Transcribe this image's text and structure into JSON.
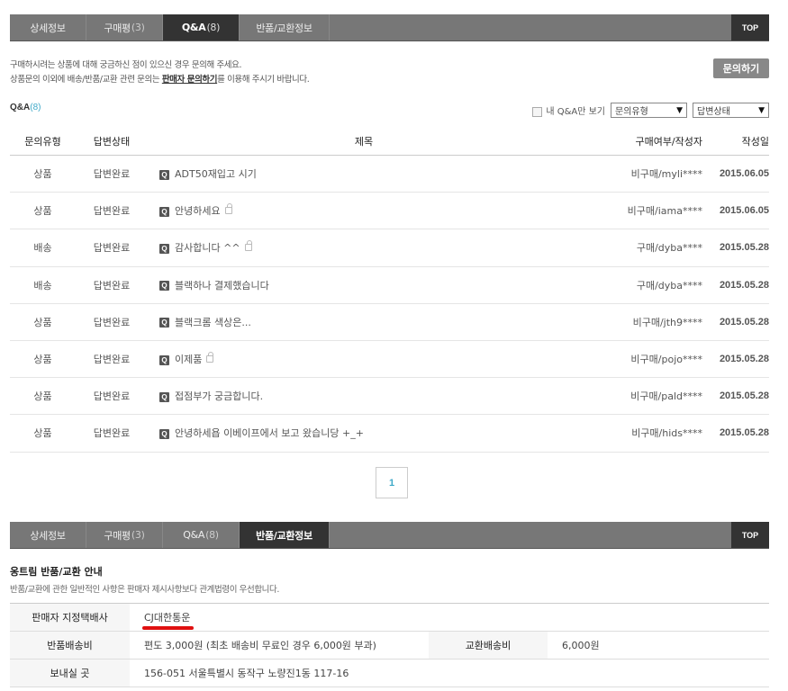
{
  "tabs_top": [
    {
      "label": "상세정보",
      "count": ""
    },
    {
      "label": "구매평",
      "count": "(3)"
    },
    {
      "label": "Q&A",
      "count": "(8)"
    },
    {
      "label": "반품/교환정보",
      "count": ""
    }
  ],
  "tabs_bottom": [
    {
      "label": "상세정보",
      "count": ""
    },
    {
      "label": "구매평",
      "count": "(3)"
    },
    {
      "label": "Q&A",
      "count": "(8)"
    },
    {
      "label": "반품/교환정보",
      "count": ""
    }
  ],
  "top_label": "TOP",
  "notice": {
    "line1": "구매하시려는 상품에 대해 궁금하신 점이 있으신 경우 문의해 주세요.",
    "line2_pre": "상품문의 이외에 배송/반품/교환 관련 문의는 ",
    "line2_link": "판매자 문의하기",
    "line2_post": "를 이용해 주시기 바랍니다."
  },
  "ask_button": "문의하기",
  "qa": {
    "label": "Q&A",
    "count": "(8)",
    "my_only": "내 Q&A만 보기",
    "filter_type": "문의유형",
    "filter_status": "답변상태",
    "headers": {
      "type": "문의유형",
      "status": "답변상태",
      "title": "제목",
      "writer": "구매여부/작성자",
      "date": "작성일"
    },
    "rows": [
      {
        "type": "상품",
        "status": "답변완료",
        "title": "ADT50재입고 시기",
        "writer": "비구매/myli****",
        "date": "2015.06.05"
      },
      {
        "type": "상품",
        "status": "답변완료",
        "title": "안녕하세요",
        "writer": "비구매/iama****",
        "date": "2015.06.05"
      },
      {
        "type": "배송",
        "status": "답변완료",
        "title": "감사합니다 ^^",
        "writer": "구매/dyba****",
        "date": "2015.05.28"
      },
      {
        "type": "배송",
        "status": "답변완료",
        "title": "블랙하나 결제했습니다",
        "writer": "구매/dyba****",
        "date": "2015.05.28"
      },
      {
        "type": "상품",
        "status": "답변완료",
        "title": "블랙크롬 색상은...",
        "writer": "비구매/jth9****",
        "date": "2015.05.28"
      },
      {
        "type": "상품",
        "status": "답변완료",
        "title": "이제품",
        "writer": "비구매/pojo****",
        "date": "2015.05.28"
      },
      {
        "type": "상품",
        "status": "답변완료",
        "title": "접점부가 궁금합니다.",
        "writer": "비구매/pald****",
        "date": "2015.05.28"
      },
      {
        "type": "상품",
        "status": "답변완료",
        "title": "안녕하세욥 이베이프에서 보고 왔습니당 +_+",
        "writer": "비구매/hids****",
        "date": "2015.05.28"
      }
    ],
    "q_icon": "Q",
    "page": "1"
  },
  "returns": {
    "title": "옹트림 반품/교환 안내",
    "subtitle": "반품/교환에 관한 일반적인 사항은 판매자 제시사항보다 관계법령이 우선합니다.",
    "courier_label": "판매자 지정택배사",
    "courier_value": "CJ대한통운",
    "return_fee_label": "반품배송비",
    "return_fee_value": "편도 3,000원 (최초 배송비 무료인 경우 6,000원 부과)",
    "exchange_fee_label": "교환배송비",
    "exchange_fee_value": "6,000원",
    "address_label": "보내실 곳",
    "address_value": "156-051 서울특별시 동작구 노량진1동 117-16"
  }
}
